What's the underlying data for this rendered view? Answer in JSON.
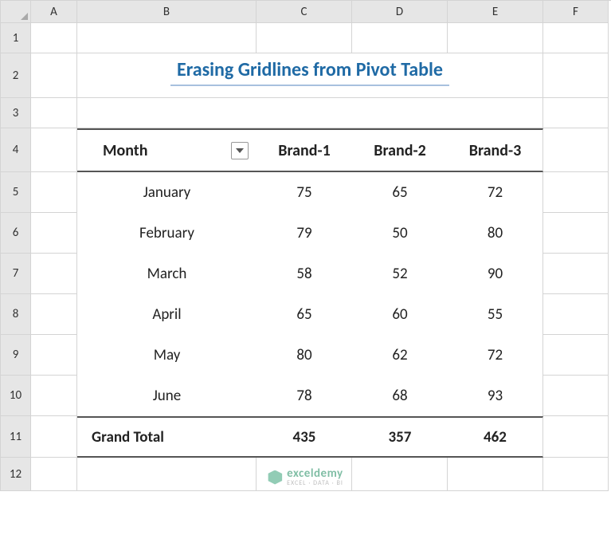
{
  "columns": [
    "A",
    "B",
    "C",
    "D",
    "E",
    "F"
  ],
  "rows": [
    "1",
    "2",
    "3",
    "4",
    "5",
    "6",
    "7",
    "8",
    "9",
    "10",
    "11",
    "12"
  ],
  "title": "Erasing Gridlines from Pivot Table",
  "pivot": {
    "row_label": "Month",
    "cols": [
      "Brand-1",
      "Brand-2",
      "Brand-3"
    ],
    "data": [
      {
        "month": "January",
        "v": [
          75,
          65,
          72
        ]
      },
      {
        "month": "February",
        "v": [
          79,
          50,
          80
        ]
      },
      {
        "month": "March",
        "v": [
          58,
          52,
          90
        ]
      },
      {
        "month": "April",
        "v": [
          65,
          60,
          55
        ]
      },
      {
        "month": "May",
        "v": [
          80,
          62,
          72
        ]
      },
      {
        "month": "June",
        "v": [
          78,
          68,
          93
        ]
      }
    ],
    "total_label": "Grand Total",
    "totals": [
      435,
      357,
      462
    ]
  },
  "watermark": {
    "name": "exceldemy",
    "tag": "EXCEL · DATA · BI"
  },
  "chart_data": {
    "type": "table",
    "title": "Erasing Gridlines from Pivot Table",
    "categories": [
      "January",
      "February",
      "March",
      "April",
      "May",
      "June"
    ],
    "series": [
      {
        "name": "Brand-1",
        "values": [
          75,
          79,
          58,
          65,
          80,
          78
        ]
      },
      {
        "name": "Brand-2",
        "values": [
          65,
          50,
          52,
          60,
          62,
          68
        ]
      },
      {
        "name": "Brand-3",
        "values": [
          72,
          80,
          90,
          55,
          72,
          93
        ]
      }
    ],
    "totals": {
      "Brand-1": 435,
      "Brand-2": 357,
      "Brand-3": 462
    }
  }
}
